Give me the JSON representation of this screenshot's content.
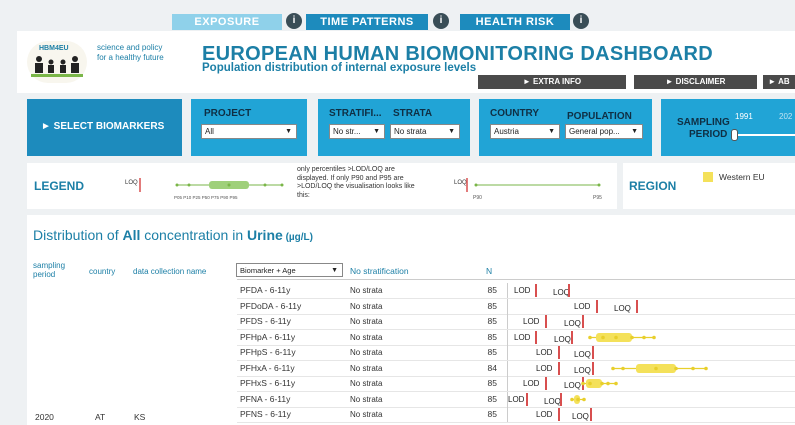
{
  "nav": {
    "tabs": [
      {
        "label": "EXPOSURE",
        "info": "i"
      },
      {
        "label": "TIME PATTERNS",
        "info": "i"
      },
      {
        "label": "HEALTH RISK",
        "info": "i"
      }
    ]
  },
  "header": {
    "logo_text": "HBM4EU",
    "tagline1": "science and policy",
    "tagline2": "for a healthy future",
    "title": "EUROPEAN HUMAN BIOMONITORING DASHBOARD",
    "subtitle": "Population distribution of internal exposure levels",
    "extra_info": "► EXTRA INFO",
    "disclaimer": "► DISCLAIMER",
    "about": "► AB"
  },
  "filters": {
    "select_biomarkers": "► SELECT BIOMARKERS",
    "project_label": "PROJECT",
    "project_value": "All",
    "stratification_label": "STRATIFI...",
    "strata_label": "STRATA",
    "stratification_value": "No str...",
    "strata_value": "No strata",
    "country_label": "COUNTRY",
    "population_label": "POPULATION",
    "country_value": "Austria",
    "population_value": "General pop...",
    "sampling_label1": "SAMPLING",
    "sampling_label2": "PERIOD",
    "sampling_start": "1991",
    "sampling_end": "202"
  },
  "legend": {
    "title": "LEGEND",
    "loq": "LOQ",
    "ticks": "P05 P10  P25  P50  P75  P90  P95",
    "note": "only percentiles >LOD/LOQ are displayed. If only P90 and P95 are >LOD/LOQ the visualisation looks like this:",
    "loq2": "LOQ",
    "p90": "P90",
    "p95": "P95"
  },
  "region": {
    "title": "REGION",
    "item": "Western EU",
    "color": "#f4e15a"
  },
  "main": {
    "heading_pre": "Distribution of ",
    "heading_all": "All",
    "heading_mid": " concentration in ",
    "heading_matrix": "Urine",
    "heading_unit": " (µg/L)",
    "col_sampling": "sampling period",
    "col_country": "country",
    "col_dcn": "data collection name",
    "biomarker_select": "Biomarker + Age",
    "col_strat": "No stratification",
    "col_n": "N",
    "sampling_value": "2020",
    "country_value": "AT",
    "dcn_value": "KS"
  },
  "rows": [
    {
      "biomarker": "PFDA - 6-11y",
      "strata": "No strata",
      "n": "85",
      "lod": "LOD",
      "loq": "LOQ"
    },
    {
      "biomarker": "PFDoDA - 6-11y",
      "strata": "No strata",
      "n": "85",
      "lod": "LOD",
      "loq": "LOQ"
    },
    {
      "biomarker": "PFDS - 6-11y",
      "strata": "No strata",
      "n": "85",
      "lod": "LOD",
      "loq": "LOQ"
    },
    {
      "biomarker": "PFHpA - 6-11y",
      "strata": "No strata",
      "n": "85",
      "lod": "LOD",
      "loq": "LOQ"
    },
    {
      "biomarker": "PFHpS - 6-11y",
      "strata": "No strata",
      "n": "85",
      "lod": "LOD",
      "loq": "LOQ"
    },
    {
      "biomarker": "PFHxA - 6-11y",
      "strata": "No strata",
      "n": "84",
      "lod": "LOD",
      "loq": "LOQ"
    },
    {
      "biomarker": "PFHxS - 6-11y",
      "strata": "No strata",
      "n": "85",
      "lod": "LOD",
      "loq": "LOQ"
    },
    {
      "biomarker": "PFNA - 6-11y",
      "strata": "No strata",
      "n": "85",
      "lod": "LOD",
      "loq": "LOQ"
    },
    {
      "biomarker": "PFNS - 6-11y",
      "strata": "No strata",
      "n": "85",
      "lod": "LOD",
      "loq": "LOQ"
    }
  ]
}
